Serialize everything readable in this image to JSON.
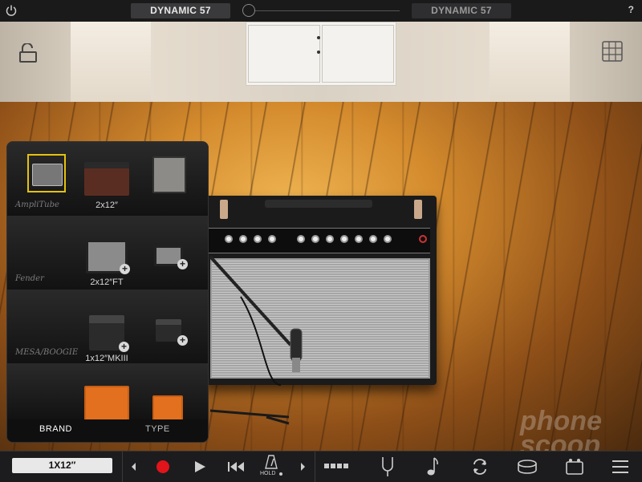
{
  "topbar": {
    "mic_left": "DYNAMIC 57",
    "mic_right": "DYNAMIC 57",
    "help": "?"
  },
  "browser": {
    "brands": [
      {
        "logo": "AmpliTube",
        "label": "2x12″"
      },
      {
        "logo": "Fender",
        "label": "2x12″FT"
      },
      {
        "logo": "MESA/BOOGIE",
        "label": "1x12″MKIII"
      },
      {
        "logo": "",
        "label": ""
      }
    ],
    "tabs": {
      "brand": "BRAND",
      "type": "TYPE"
    }
  },
  "bottombar": {
    "preset": "1X12″",
    "hold_label": "HOLD"
  },
  "watermark": {
    "line1": "phone",
    "line2": "scoop"
  },
  "colors": {
    "accent_selection": "#e4c20f",
    "record": "#e0141a"
  }
}
